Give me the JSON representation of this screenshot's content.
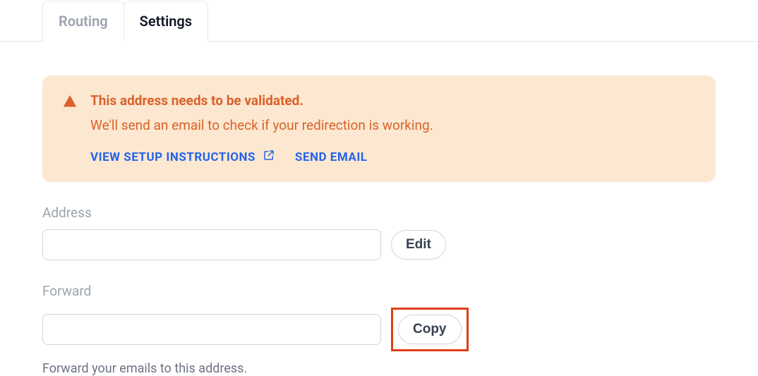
{
  "tabs": {
    "routing": "Routing",
    "settings": "Settings"
  },
  "alert": {
    "title": "This address needs to be validated.",
    "body": "We'll send an email to check if your redirection is working.",
    "view_instructions": "View Setup Instructions",
    "send_email": "Send Email"
  },
  "address": {
    "label": "Address",
    "value": "",
    "edit": "Edit"
  },
  "forward": {
    "label": "Forward",
    "value": "",
    "copy": "Copy",
    "help": "Forward your emails to this address."
  }
}
